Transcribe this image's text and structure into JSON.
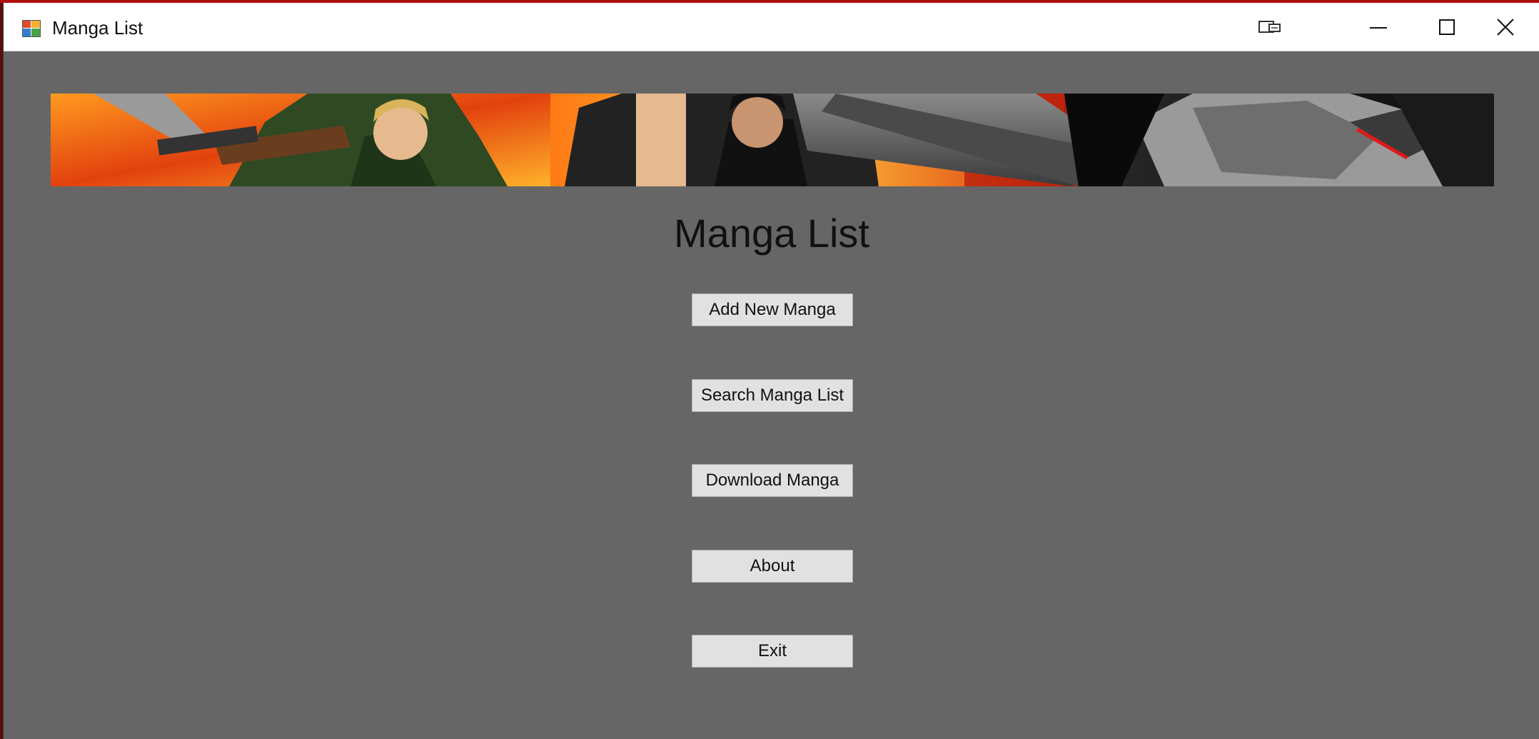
{
  "window": {
    "title": "Manga List",
    "controls": {
      "restore_icon": "tablet-mode-icon",
      "minimize_icon": "minimize-icon",
      "maximize_icon": "maximize-icon",
      "close_icon": "close-icon"
    }
  },
  "banner": {
    "image": "anime-characters-banner"
  },
  "main": {
    "title": "Manga List",
    "buttons": [
      {
        "label": "Add New Manga"
      },
      {
        "label": "Search Manga List"
      },
      {
        "label": "Download Manga"
      },
      {
        "label": "About"
      },
      {
        "label": "Exit"
      }
    ]
  },
  "colors": {
    "form_background": "#666666",
    "button_face": "#e1e1e1",
    "button_border": "#adadad",
    "titlebar": "#ffffff"
  }
}
